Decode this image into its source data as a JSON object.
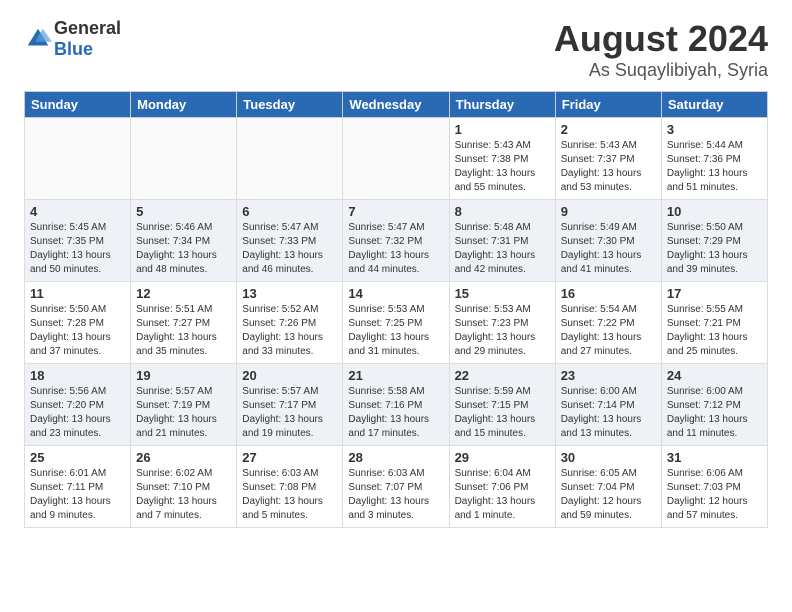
{
  "header": {
    "logo": {
      "general": "General",
      "blue": "Blue"
    },
    "title": "August 2024",
    "location": "As Suqaylibiyah, Syria"
  },
  "days_of_week": [
    "Sunday",
    "Monday",
    "Tuesday",
    "Wednesday",
    "Thursday",
    "Friday",
    "Saturday"
  ],
  "weeks": [
    {
      "class": "row-norm",
      "days": [
        {
          "num": "",
          "info": "",
          "empty": true
        },
        {
          "num": "",
          "info": "",
          "empty": true
        },
        {
          "num": "",
          "info": "",
          "empty": true
        },
        {
          "num": "",
          "info": "",
          "empty": true
        },
        {
          "num": "1",
          "info": "Sunrise: 5:43 AM\nSunset: 7:38 PM\nDaylight: 13 hours\nand 55 minutes.",
          "empty": false
        },
        {
          "num": "2",
          "info": "Sunrise: 5:43 AM\nSunset: 7:37 PM\nDaylight: 13 hours\nand 53 minutes.",
          "empty": false
        },
        {
          "num": "3",
          "info": "Sunrise: 5:44 AM\nSunset: 7:36 PM\nDaylight: 13 hours\nand 51 minutes.",
          "empty": false
        }
      ]
    },
    {
      "class": "row-alt",
      "days": [
        {
          "num": "4",
          "info": "Sunrise: 5:45 AM\nSunset: 7:35 PM\nDaylight: 13 hours\nand 50 minutes.",
          "empty": false
        },
        {
          "num": "5",
          "info": "Sunrise: 5:46 AM\nSunset: 7:34 PM\nDaylight: 13 hours\nand 48 minutes.",
          "empty": false
        },
        {
          "num": "6",
          "info": "Sunrise: 5:47 AM\nSunset: 7:33 PM\nDaylight: 13 hours\nand 46 minutes.",
          "empty": false
        },
        {
          "num": "7",
          "info": "Sunrise: 5:47 AM\nSunset: 7:32 PM\nDaylight: 13 hours\nand 44 minutes.",
          "empty": false
        },
        {
          "num": "8",
          "info": "Sunrise: 5:48 AM\nSunset: 7:31 PM\nDaylight: 13 hours\nand 42 minutes.",
          "empty": false
        },
        {
          "num": "9",
          "info": "Sunrise: 5:49 AM\nSunset: 7:30 PM\nDaylight: 13 hours\nand 41 minutes.",
          "empty": false
        },
        {
          "num": "10",
          "info": "Sunrise: 5:50 AM\nSunset: 7:29 PM\nDaylight: 13 hours\nand 39 minutes.",
          "empty": false
        }
      ]
    },
    {
      "class": "row-norm",
      "days": [
        {
          "num": "11",
          "info": "Sunrise: 5:50 AM\nSunset: 7:28 PM\nDaylight: 13 hours\nand 37 minutes.",
          "empty": false
        },
        {
          "num": "12",
          "info": "Sunrise: 5:51 AM\nSunset: 7:27 PM\nDaylight: 13 hours\nand 35 minutes.",
          "empty": false
        },
        {
          "num": "13",
          "info": "Sunrise: 5:52 AM\nSunset: 7:26 PM\nDaylight: 13 hours\nand 33 minutes.",
          "empty": false
        },
        {
          "num": "14",
          "info": "Sunrise: 5:53 AM\nSunset: 7:25 PM\nDaylight: 13 hours\nand 31 minutes.",
          "empty": false
        },
        {
          "num": "15",
          "info": "Sunrise: 5:53 AM\nSunset: 7:23 PM\nDaylight: 13 hours\nand 29 minutes.",
          "empty": false
        },
        {
          "num": "16",
          "info": "Sunrise: 5:54 AM\nSunset: 7:22 PM\nDaylight: 13 hours\nand 27 minutes.",
          "empty": false
        },
        {
          "num": "17",
          "info": "Sunrise: 5:55 AM\nSunset: 7:21 PM\nDaylight: 13 hours\nand 25 minutes.",
          "empty": false
        }
      ]
    },
    {
      "class": "row-alt",
      "days": [
        {
          "num": "18",
          "info": "Sunrise: 5:56 AM\nSunset: 7:20 PM\nDaylight: 13 hours\nand 23 minutes.",
          "empty": false
        },
        {
          "num": "19",
          "info": "Sunrise: 5:57 AM\nSunset: 7:19 PM\nDaylight: 13 hours\nand 21 minutes.",
          "empty": false
        },
        {
          "num": "20",
          "info": "Sunrise: 5:57 AM\nSunset: 7:17 PM\nDaylight: 13 hours\nand 19 minutes.",
          "empty": false
        },
        {
          "num": "21",
          "info": "Sunrise: 5:58 AM\nSunset: 7:16 PM\nDaylight: 13 hours\nand 17 minutes.",
          "empty": false
        },
        {
          "num": "22",
          "info": "Sunrise: 5:59 AM\nSunset: 7:15 PM\nDaylight: 13 hours\nand 15 minutes.",
          "empty": false
        },
        {
          "num": "23",
          "info": "Sunrise: 6:00 AM\nSunset: 7:14 PM\nDaylight: 13 hours\nand 13 minutes.",
          "empty": false
        },
        {
          "num": "24",
          "info": "Sunrise: 6:00 AM\nSunset: 7:12 PM\nDaylight: 13 hours\nand 11 minutes.",
          "empty": false
        }
      ]
    },
    {
      "class": "row-norm",
      "days": [
        {
          "num": "25",
          "info": "Sunrise: 6:01 AM\nSunset: 7:11 PM\nDaylight: 13 hours\nand 9 minutes.",
          "empty": false
        },
        {
          "num": "26",
          "info": "Sunrise: 6:02 AM\nSunset: 7:10 PM\nDaylight: 13 hours\nand 7 minutes.",
          "empty": false
        },
        {
          "num": "27",
          "info": "Sunrise: 6:03 AM\nSunset: 7:08 PM\nDaylight: 13 hours\nand 5 minutes.",
          "empty": false
        },
        {
          "num": "28",
          "info": "Sunrise: 6:03 AM\nSunset: 7:07 PM\nDaylight: 13 hours\nand 3 minutes.",
          "empty": false
        },
        {
          "num": "29",
          "info": "Sunrise: 6:04 AM\nSunset: 7:06 PM\nDaylight: 13 hours\nand 1 minute.",
          "empty": false
        },
        {
          "num": "30",
          "info": "Sunrise: 6:05 AM\nSunset: 7:04 PM\nDaylight: 12 hours\nand 59 minutes.",
          "empty": false
        },
        {
          "num": "31",
          "info": "Sunrise: 6:06 AM\nSunset: 7:03 PM\nDaylight: 12 hours\nand 57 minutes.",
          "empty": false
        }
      ]
    }
  ]
}
